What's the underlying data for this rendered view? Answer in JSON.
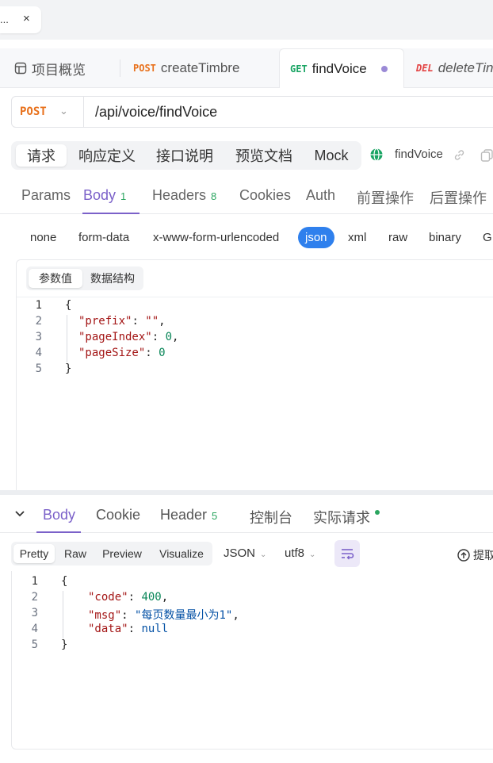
{
  "window_tab": {
    "label": "...",
    "close": "×"
  },
  "api_tabs": [
    {
      "method": "",
      "label": "项目概览"
    },
    {
      "method": "POST",
      "label": "createTimbre"
    },
    {
      "method": "GET",
      "label": "findVoice"
    },
    {
      "method": "DEL",
      "label": "deleteTin"
    }
  ],
  "url_bar": {
    "method": "POST",
    "path": "/api/voice/findVoice"
  },
  "section_tabs": [
    "请求",
    "响应定义",
    "接口说明",
    "预览文档",
    "Mock"
  ],
  "api_name": "findVoice",
  "request_tabs": {
    "items": [
      {
        "label": "Params",
        "badge": ""
      },
      {
        "label": "Body",
        "badge": "1"
      },
      {
        "label": "Headers",
        "badge": "8"
      },
      {
        "label": "Cookies",
        "badge": ""
      },
      {
        "label": "Auth",
        "badge": ""
      },
      {
        "label": "前置操作",
        "badge": ""
      },
      {
        "label": "后置操作",
        "badge": ""
      }
    ],
    "active": "Body"
  },
  "body_types": [
    "none",
    "form-data",
    "x-www-form-urlencoded",
    "json",
    "xml",
    "raw",
    "binary",
    "G"
  ],
  "body_type_active": "json",
  "editor_tabs": [
    "参数值",
    "数据结构"
  ],
  "request_body": {
    "line_numbers": [
      "1",
      "2",
      "3",
      "4",
      "5"
    ],
    "open": "{",
    "close": "}",
    "prefix_key": "\"prefix\"",
    "prefix_val": "\"\"",
    "pageIndex_key": "\"pageIndex\"",
    "pageIndex_val": "0",
    "pageSize_key": "\"pageSize\"",
    "pageSize_val": "0"
  },
  "response_tabs": [
    {
      "label": "Body",
      "badge": ""
    },
    {
      "label": "Cookie",
      "badge": ""
    },
    {
      "label": "Header",
      "badge": "5"
    },
    {
      "label": "控制台",
      "badge": ""
    },
    {
      "label": "实际请求",
      "badge": ""
    }
  ],
  "response_format_tabs": [
    "Pretty",
    "Raw",
    "Preview",
    "Visualize"
  ],
  "response_lang": "JSON",
  "response_encoding": "utf8",
  "extract_label": "提取",
  "response_body": {
    "line_numbers": [
      "1",
      "2",
      "3",
      "4",
      "5"
    ],
    "open": "{",
    "close": "}",
    "code_key": "\"code\"",
    "code_val": "400",
    "msg_key": "\"msg\"",
    "msg_val": "\"每页数量最小为1\"",
    "data_key": "\"data\"",
    "data_val": "null"
  },
  "colors": {
    "accent": "#7b61c9",
    "post": "#e8711c",
    "get": "#19a463",
    "del": "#e34545",
    "json_active": "#2f80ed"
  }
}
